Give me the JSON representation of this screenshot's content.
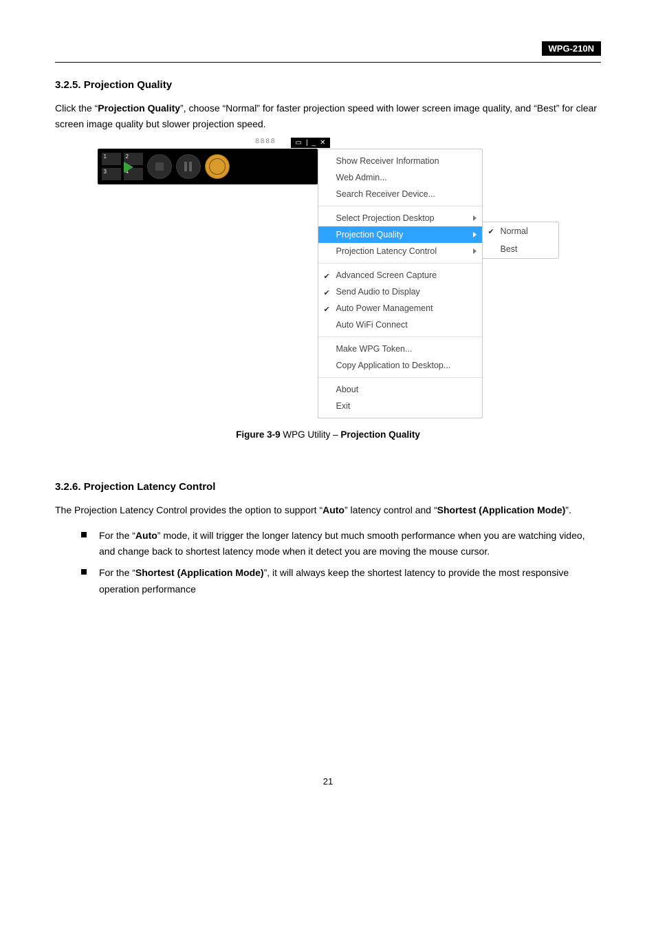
{
  "doc": {
    "device": "WPG-210N",
    "pageNumber": "21"
  },
  "s1": {
    "heading": "3.2.5.  Projection Quality",
    "p_a": "Click the “",
    "p_b": "Projection Quality",
    "p_c": "”, choose “Normal” for faster projection speed with lower screen image quality, and “Best” for clear screen image quality but slower projection speed.",
    "fig_a": "Figure 3-9",
    "fig_b": " WPG Utility – ",
    "fig_c": "Projection Quality"
  },
  "s2": {
    "heading": "3.2.6.  Projection Latency Control",
    "p_a": "The Projection Latency Control provides the option to support “",
    "p_b": "Auto",
    "p_c": "” latency control and “",
    "p_d": "Shortest (Application Mode)",
    "p_e": "”.",
    "li1_a": "For the “",
    "li1_b": "Auto",
    "li1_c": "” mode, it will trigger the longer latency but much smooth performance when you are watching video, and change back to shortest latency mode when it detect you are moving the mouse cursor.",
    "li2_a": "For the “",
    "li2_b": "Shortest (Application Mode)",
    "li2_c": "”, it will always keep the shortest latency to provide the most responsive operation performance"
  },
  "menu": {
    "code": "8888",
    "g1": {
      "a": "Show Receiver Information",
      "b": "Web Admin...",
      "c": "Search Receiver Device..."
    },
    "g2": {
      "a": "Select Projection Desktop",
      "b": "Projection Quality",
      "c": "Projection Latency Control"
    },
    "g3": {
      "a": "Advanced Screen Capture",
      "b": "Send Audio to Display",
      "c": "Auto Power Management",
      "d": "Auto WiFi Connect"
    },
    "g4": {
      "a": "Make WPG Token...",
      "b": "Copy Application to Desktop..."
    },
    "g5": {
      "a": "About",
      "b": "Exit"
    },
    "sub": {
      "a": "Normal",
      "b": "Best"
    }
  }
}
